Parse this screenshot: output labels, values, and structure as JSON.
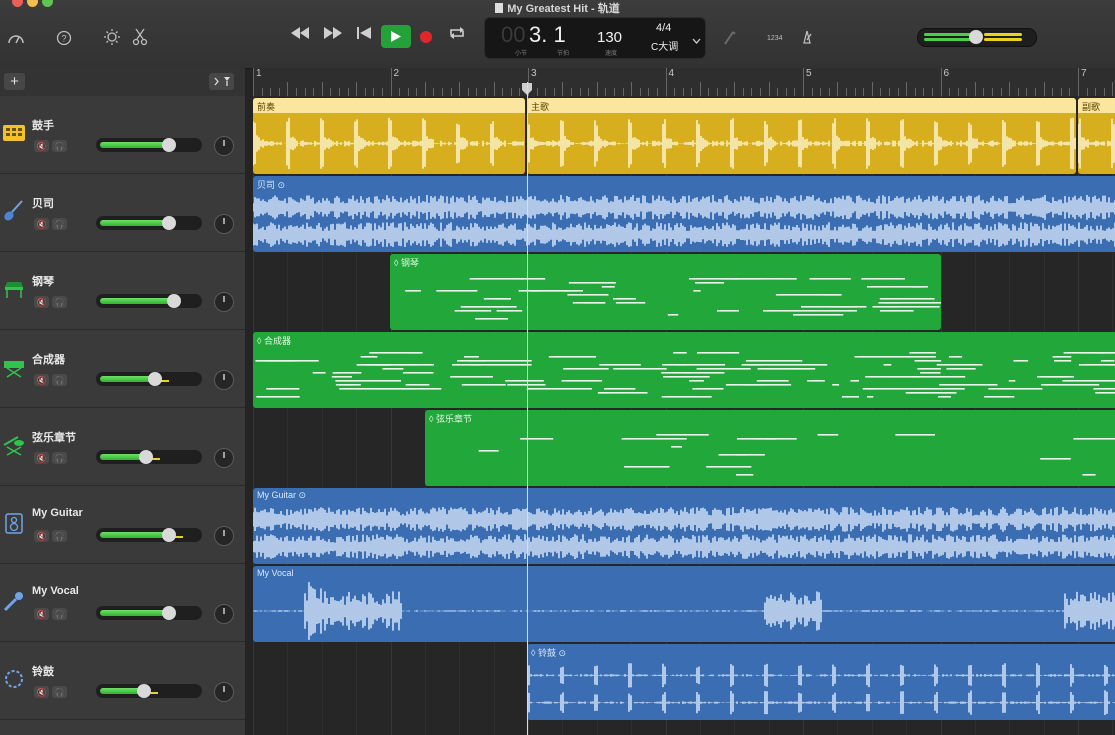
{
  "window": {
    "title": "My Greatest Hit - 轨道"
  },
  "lcd": {
    "bar_beat": "3. 1",
    "bar_beat_dim": "00",
    "label_bar": "小节",
    "label_beat": "节拍",
    "tempo": "130",
    "label_tempo": "速度",
    "time_sig": "4/4",
    "key": "C大调"
  },
  "toolbar": {
    "count_in": "1234"
  },
  "ruler": {
    "bars": [
      "1",
      "2",
      "3",
      "4",
      "5",
      "6",
      "7"
    ]
  },
  "tracks": [
    {
      "name": "鼓手",
      "type": "drummer",
      "volume": 0.75,
      "color": "#d6ae1e"
    },
    {
      "name": "贝司",
      "type": "bass",
      "volume": 0.75,
      "color": "#3a6db1"
    },
    {
      "name": "钢琴",
      "type": "piano",
      "volume": 0.8,
      "color": "#22a83a"
    },
    {
      "name": "合成器",
      "type": "synth",
      "volume": 0.6,
      "color": "#22a83a"
    },
    {
      "name": "弦乐章节",
      "type": "strings",
      "volume": 0.5,
      "color": "#22a83a"
    },
    {
      "name": "My Guitar",
      "type": "guitar",
      "volume": 0.75,
      "color": "#3a6db1"
    },
    {
      "name": "My Vocal",
      "type": "vocal",
      "volume": 0.75,
      "color": "#3a6db1"
    },
    {
      "name": "铃鼓",
      "type": "tambourine",
      "volume": 0.48,
      "color": "#3a6db1"
    }
  ],
  "regions": {
    "drummer": [
      {
        "label": "前奏"
      },
      {
        "label": "主歌"
      },
      {
        "label": "副歌"
      }
    ],
    "bass": "贝司",
    "piano": "钢琴",
    "synth": "合成器",
    "strings": "弦乐章节",
    "guitar": "My Guitar",
    "vocal": "My Vocal",
    "tambourine": "铃鼓"
  },
  "colors": {
    "drummer": "#d6ae1e",
    "audio": "#3a6db1",
    "midi": "#22a83a",
    "play": "#23a23a",
    "record": "#e0282c"
  },
  "icons": [
    "library-icon",
    "help-icon",
    "smart-controls-icon",
    "editors-icon",
    "rewind-icon",
    "fast-forward-icon",
    "go-to-start-icon",
    "play-icon",
    "record-icon",
    "cycle-icon",
    "tuner-icon",
    "metronome-icon",
    "add-track-icon",
    "catch-playhead-icon"
  ]
}
